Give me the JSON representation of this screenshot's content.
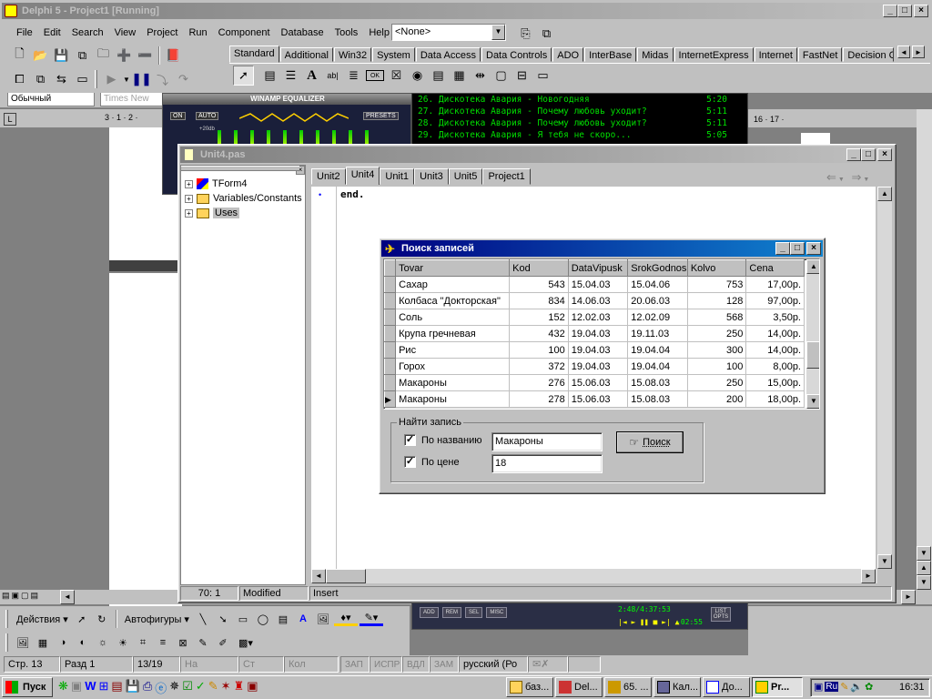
{
  "ide": {
    "title": "Delphi 5 - Project1 [Running]",
    "menu": [
      "File",
      "Edit",
      "Search",
      "View",
      "Project",
      "Run",
      "Component",
      "Database",
      "Tools",
      "Help"
    ],
    "config_select": "<None>",
    "palette_tabs": [
      "Standard",
      "Additional",
      "Win32",
      "System",
      "Data Access",
      "Data Controls",
      "ADO",
      "InterBase",
      "Midas",
      "InternetExpress",
      "Internet",
      "FastNet",
      "Decision C"
    ]
  },
  "word": {
    "style_select": "Обычный",
    "font_select": "Times New",
    "ruler_left": "3 · 1 · 2 ·",
    "ruler_right": "16 · 17 ·"
  },
  "winamp": {
    "eq_title": "WINAMP EQUALIZER",
    "on": "ON",
    "auto": "AUTO",
    "presets": "PRESETS",
    "db": "+20db",
    "playlist": [
      {
        "text": "26. Дискотека Авария - Новогодняя",
        "time": "5:20"
      },
      {
        "text": "27. Дискотека Авария - Почему любовь уходит?",
        "time": "5:11"
      },
      {
        "text": "28. Дискотека Авария - Почему любовь уходит?",
        "time": "5:11"
      },
      {
        "text": "29. Дискотека Авария - Я тебя не скоро...",
        "time": "5:05"
      }
    ],
    "pl_buttons": [
      "ADD",
      "REM",
      "SEL",
      "MISC"
    ],
    "pl_time": "2:48/4:37:53",
    "pl_remain": "-02:55",
    "list_opts": "LIST OPTS"
  },
  "editor": {
    "title": "Unit4.pas",
    "tree": [
      "TForm4",
      "Variables/Constants",
      "Uses"
    ],
    "tabs": [
      "Unit2",
      "Unit4",
      "Unit1",
      "Unit3",
      "Unit5",
      "Project1"
    ],
    "selected_tab": "Unit4",
    "code": "end.",
    "status": {
      "pos": "70:  1",
      "state": "Modified",
      "mode": "Insert"
    }
  },
  "dialog": {
    "title": "Поиск записей",
    "columns": [
      "Tovar",
      "Kod",
      "DataVipusk",
      "SrokGodnos",
      "Kolvo",
      "Cena"
    ],
    "rows": [
      [
        "Сахар",
        "543",
        "15.04.03",
        "15.04.06",
        "753",
        "17,00р."
      ],
      [
        "Колбаса \"Докторская\"",
        "834",
        "14.06.03",
        "20.06.03",
        "128",
        "97,00р."
      ],
      [
        "Соль",
        "152",
        "12.02.03",
        "12.02.09",
        "568",
        "3,50р."
      ],
      [
        "Крупа гречневая",
        "432",
        "19.04.03",
        "19.11.03",
        "250",
        "14,00р."
      ],
      [
        "Рис",
        "100",
        "19.04.03",
        "19.04.04",
        "300",
        "14,00р."
      ],
      [
        "Горох",
        "372",
        "19.04.03",
        "19.04.04",
        "100",
        "8,00р."
      ],
      [
        "Макароны",
        "276",
        "15.06.03",
        "15.08.03",
        "250",
        "15,00р."
      ],
      [
        "Макароны",
        "278",
        "15.06.03",
        "15.08.03",
        "200",
        "18,00р."
      ]
    ],
    "group_label": "Найти запись",
    "by_name_label": "По названию",
    "by_name_checked": true,
    "by_name_value": "Макароны",
    "by_price_label": "По цене",
    "by_price_checked": true,
    "by_price_value": "18",
    "search_button": "Поиск"
  },
  "word_draw": {
    "actions": "Действия",
    "autoshapes": "Автофигуры"
  },
  "word_status": [
    "Стр. 13",
    "Разд 1",
    "13/19",
    "На",
    "Ст",
    "Кол",
    "ЗАП",
    "ИСПР",
    "ВДЛ",
    "ЗАМ",
    "русский (Ро"
  ],
  "taskbar": {
    "start": "Пуск",
    "tasks": [
      "баз...",
      "Del...",
      "65. ...",
      "Кал...",
      "До...",
      "Pr..."
    ],
    "active_task": "Pr...",
    "tray_lang": "Ru",
    "clock": "16:31"
  }
}
